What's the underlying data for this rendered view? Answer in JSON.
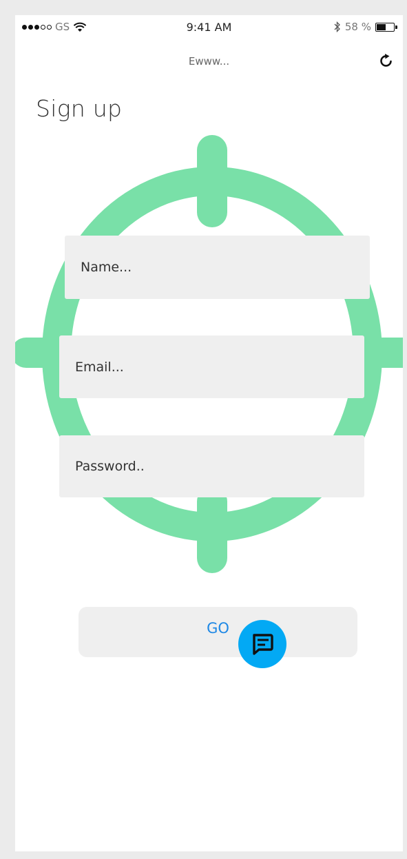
{
  "status_bar": {
    "carrier": "GS",
    "time": "9:41 AM",
    "battery_percent": "58 %",
    "battery_level": 0.58
  },
  "header": {
    "title": "Ewww..."
  },
  "page": {
    "title": "Sign up"
  },
  "form": {
    "name_placeholder": "Name...",
    "email_placeholder": "Email...",
    "password_placeholder": "Password..",
    "submit_label": "GO"
  },
  "icons": {
    "refresh": "refresh-icon",
    "chat": "chat-icon",
    "target": "crosshair-target-illustration"
  },
  "colors": {
    "target_green": "#79e0a8",
    "field_bg": "#efefef",
    "accent_blue": "#1e88e5",
    "fab_blue": "#03a9f4"
  }
}
